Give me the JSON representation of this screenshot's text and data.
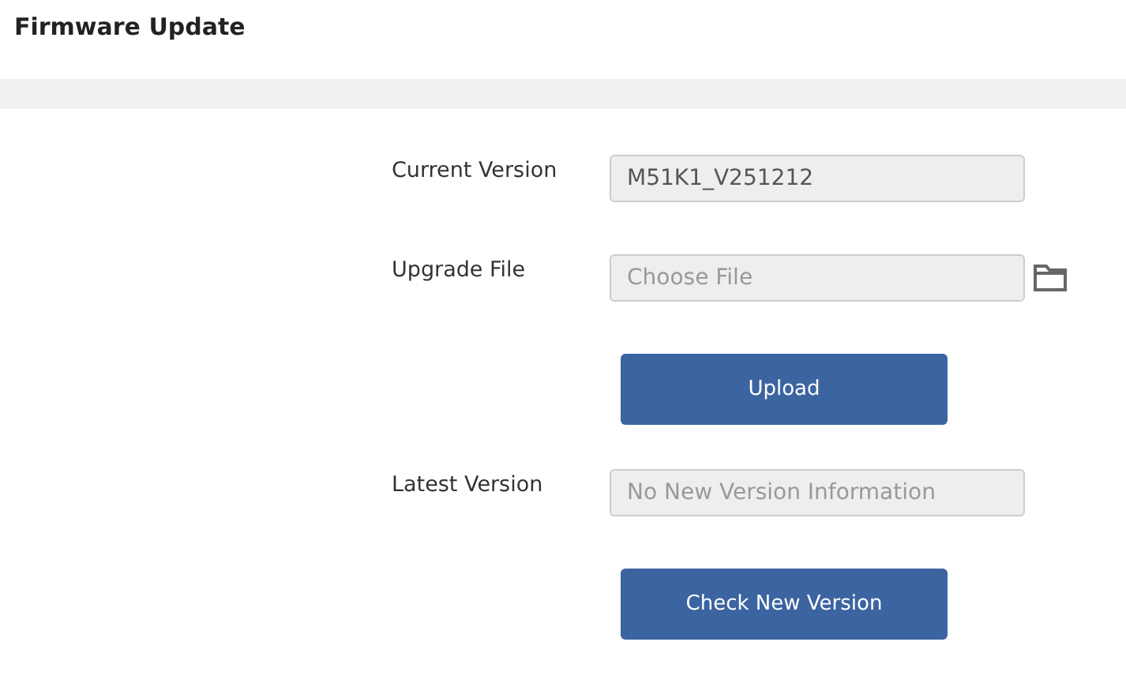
{
  "title": "Firmware Update",
  "rows": [
    {
      "kind": "field",
      "label": "Current Version",
      "value": "M51K1_V251212"
    },
    {
      "kind": "file",
      "label": "Upgrade File",
      "placeholder": "Choose File"
    },
    {
      "kind": "button",
      "label": "Upload"
    },
    {
      "kind": "field",
      "label": "Latest Version",
      "placeholder": "No New Version Information"
    },
    {
      "kind": "button",
      "label": "Check New Version"
    }
  ]
}
